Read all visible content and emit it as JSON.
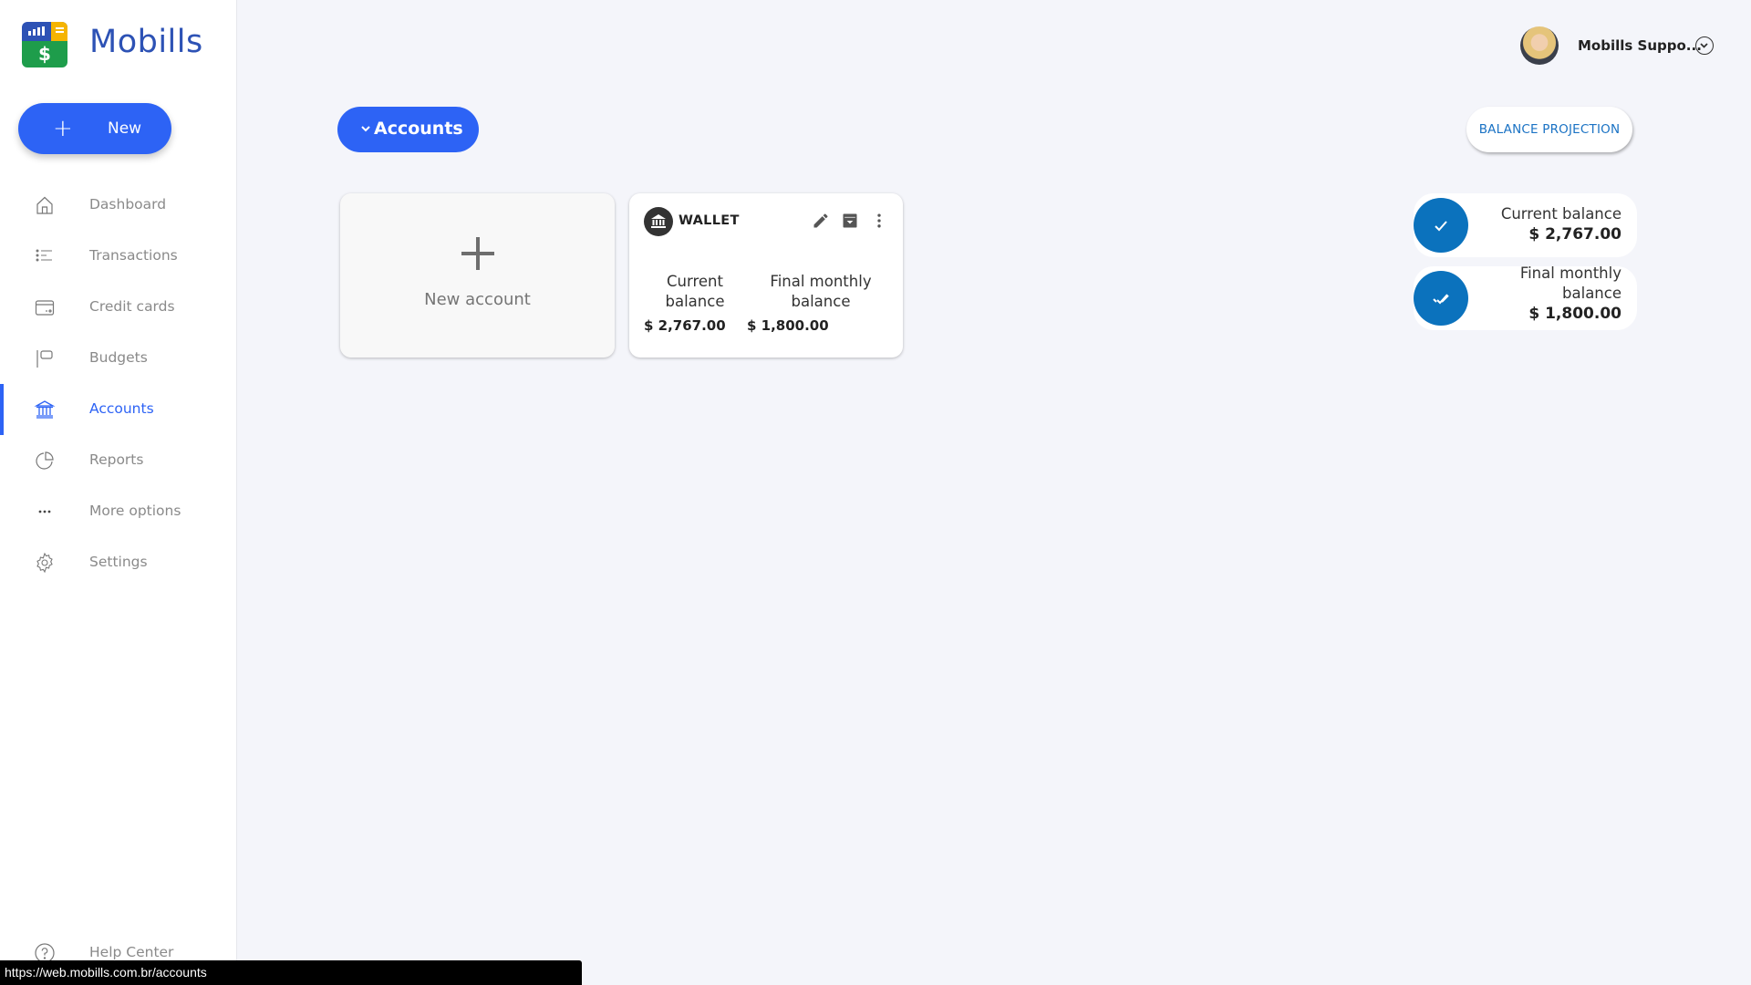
{
  "app": {
    "name": "Mobills"
  },
  "sidebar": {
    "new_label": "New",
    "items": [
      {
        "label": "Dashboard",
        "icon": "home-icon",
        "active": false
      },
      {
        "label": "Transactions",
        "icon": "list-icon",
        "active": false
      },
      {
        "label": "Credit cards",
        "icon": "credit-card-icon",
        "active": false
      },
      {
        "label": "Budgets",
        "icon": "flag-icon",
        "active": false
      },
      {
        "label": "Accounts",
        "icon": "bank-icon",
        "active": true
      },
      {
        "label": "Reports",
        "icon": "pie-chart-icon",
        "active": false
      },
      {
        "label": "More options",
        "icon": "more-horizontal-icon",
        "active": false
      },
      {
        "label": "Settings",
        "icon": "gear-icon",
        "active": false
      }
    ],
    "help_label": "Help Center"
  },
  "header": {
    "user_name": "Mobills Suppo..."
  },
  "main": {
    "accounts_button_label": "Accounts",
    "balance_projection_label": "BALANCE PROJECTION",
    "new_account_label": "New account",
    "accounts": [
      {
        "name": "WALLET",
        "current_balance_label": "Current balance",
        "current_balance": "$ 2,767.00",
        "final_balance_label": "Final monthly balance",
        "final_balance": "$ 1,800.00"
      }
    ],
    "summary": {
      "current_label": "Current balance",
      "current_value": "$ 2,767.00",
      "final_label_line1": "Final monthly",
      "final_label_line2": "balance",
      "final_value": "$ 1,800.00"
    }
  },
  "status_bar": {
    "url": "https://web.mobills.com.br/accounts"
  },
  "colors": {
    "primary": "#2d63f5",
    "brand": "#2d52b5",
    "summary_circle": "#0b72bd",
    "projection_text": "#1a72c4"
  }
}
